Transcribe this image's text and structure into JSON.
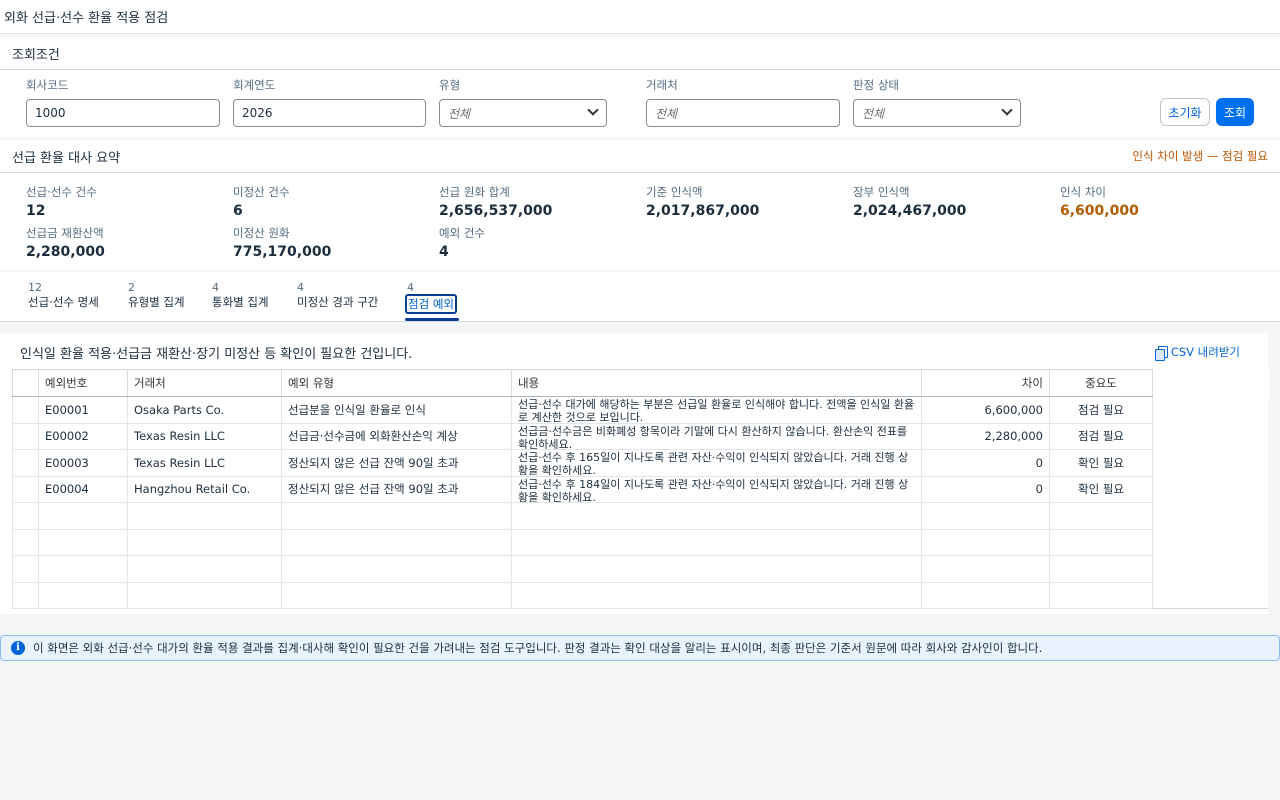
{
  "app": {
    "title": "외화 선급·선수 환율 적용 점검"
  },
  "filters": {
    "title": "조회조건",
    "company": {
      "label": "회사코드",
      "value": "1000"
    },
    "year": {
      "label": "회계연도",
      "value": "2026"
    },
    "type": {
      "label": "유형",
      "placeholder": "전체"
    },
    "partner": {
      "label": "거래처",
      "placeholder": "전체"
    },
    "status": {
      "label": "판정 상태",
      "placeholder": "전체"
    },
    "reset_label": "초기화",
    "search_label": "조회"
  },
  "summary": {
    "title": "선급 환율 대사 요약",
    "warning": "인식 차이 발생 — 점검 필요",
    "kpis": [
      {
        "label": "선급·선수 건수",
        "value": "12"
      },
      {
        "label": "미정산 건수",
        "value": "6"
      },
      {
        "label": "선급 원화 합계",
        "value": "2,656,537,000"
      },
      {
        "label": "기준 인식액",
        "value": "2,017,867,000"
      },
      {
        "label": "장부 인식액",
        "value": "2,024,467,000"
      },
      {
        "label": "인식 차이",
        "value": "6,600,000"
      },
      {
        "label": "선급금 재환산액",
        "value": "2,280,000"
      },
      {
        "label": "미정산 원화",
        "value": "775,170,000"
      },
      {
        "label": "예외 건수",
        "value": "4"
      }
    ]
  },
  "tabs": [
    {
      "count": "12",
      "label": "선급·선수 명세"
    },
    {
      "count": "2",
      "label": "유형별 집계"
    },
    {
      "count": "4",
      "label": "통화별 집계"
    },
    {
      "count": "4",
      "label": "미정산 경과 구간"
    },
    {
      "count": "4",
      "label": "점검 예외"
    }
  ],
  "exceptions": {
    "description": "인식일 환율 적용·선급금 재환산·장기 미정산 등 확인이 필요한 건입니다.",
    "csv_label": "CSV 내려받기",
    "columns": [
      "예외번호",
      "거래처",
      "예외 유형",
      "내용",
      "차이",
      "중요도"
    ],
    "rows": [
      {
        "id": "E00001",
        "partner": "Osaka Parts Co.",
        "type": "선급분을 인식일 환율로 인식",
        "desc": "선급·선수 대가에 해당하는 부분은 선급일 환율로 인식해야 합니다. 전액을 인식일 환율로 계산한 것으로 보입니다.",
        "diff": "6,600,000",
        "severity": "점검 필요"
      },
      {
        "id": "E00002",
        "partner": "Texas Resin LLC",
        "type": "선급금·선수금에 외화환산손익 계상",
        "desc": "선급금·선수금은 비화폐성 항목이라 기말에 다시 환산하지 않습니다. 환산손익 전표를 확인하세요.",
        "diff": "2,280,000",
        "severity": "점검 필요"
      },
      {
        "id": "E00003",
        "partner": "Texas Resin LLC",
        "type": "정산되지 않은 선급 잔액 90일 초과",
        "desc": "선급·선수 후 165일이 지나도록 관련 자산·수익이 인식되지 않았습니다. 거래 진행 상황을 확인하세요.",
        "diff": "0",
        "severity": "확인 필요"
      },
      {
        "id": "E00004",
        "partner": "Hangzhou Retail Co.",
        "type": "정산되지 않은 선급 잔액 90일 초과",
        "desc": "선급·선수 후 184일이 지나도록 관련 자산·수익이 인식되지 않았습니다. 거래 진행 상황을 확인하세요.",
        "diff": "0",
        "severity": "확인 필요"
      }
    ]
  },
  "notice": "이 화면은 외화 선급·선수 대가의 환율 적용 결과를 집계·대사해 확인이 필요한 건을 가려내는 점검 도구입니다. 판정 결과는 확인 대상을 알리는 표시이며, 최종 판단은 기준서 원문에 따라 회사와 감사인이 합니다.",
  "colors": {
    "accent": "#0070f2",
    "warning": "#c35500",
    "info": "#0064d9"
  }
}
